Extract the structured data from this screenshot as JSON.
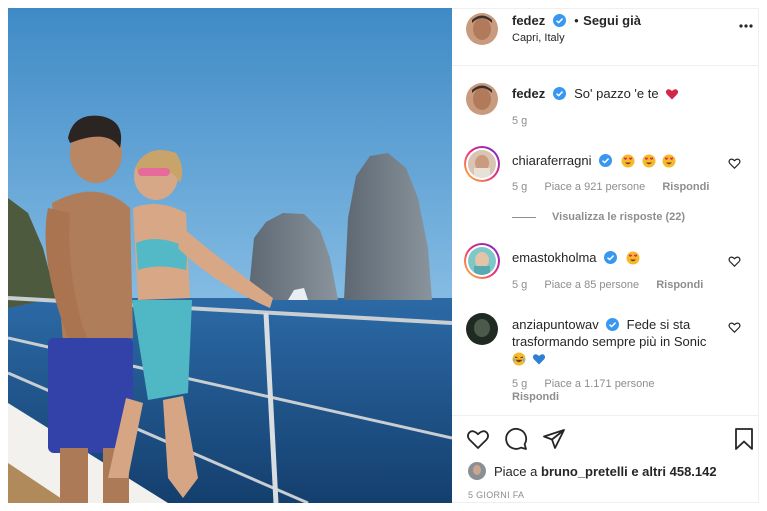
{
  "post": {
    "username": "fedez",
    "follow_status": "Segui già",
    "location": "Capri, Italy",
    "more_icon": "more-options-icon"
  },
  "caption": {
    "username": "fedez",
    "text": "So' pazzo 'e te",
    "emoji": "heart-emoji",
    "age": "5 g"
  },
  "comments": [
    {
      "username": "chiaraferragni",
      "verified": true,
      "text": "",
      "emoji": [
        "heart-eyes-emoji",
        "heart-eyes-emoji",
        "heart-eyes-emoji"
      ],
      "age": "5 g",
      "likes": "Piace a 921 persone",
      "reply": "Rispondi",
      "view_replies": "Visualizza le risposte (22)"
    },
    {
      "username": "emastokholma",
      "verified": true,
      "text": "",
      "emoji": [
        "heart-eyes-emoji"
      ],
      "age": "5 g",
      "likes": "Piace a 85 persone",
      "reply": "Rispondi"
    },
    {
      "username": "anziapuntowav",
      "verified": true,
      "text_line1": "Fede si sta",
      "text_line2": "trasformando sempre più in Sonic",
      "emoji": [
        "laughing-emoji",
        "blue-heart-emoji"
      ],
      "age": "5 g",
      "likes": "Piace a 1.171 persone",
      "reply": "Rispondi"
    }
  ],
  "actions": {
    "icons": [
      "like-heart-icon",
      "comment-icon",
      "share-icon",
      "save-bookmark-icon"
    ]
  },
  "likes_summary": {
    "prefix": "Piace a",
    "user": "bruno_pretelli",
    "suffix": "e altri 458.142"
  },
  "timestamp": "5 GIORNI FA",
  "colors": {
    "verified_blue": "#3897f0",
    "muted_text": "#8e8e8e",
    "sky": "#4f93c9",
    "sea": "#1d4f86"
  }
}
